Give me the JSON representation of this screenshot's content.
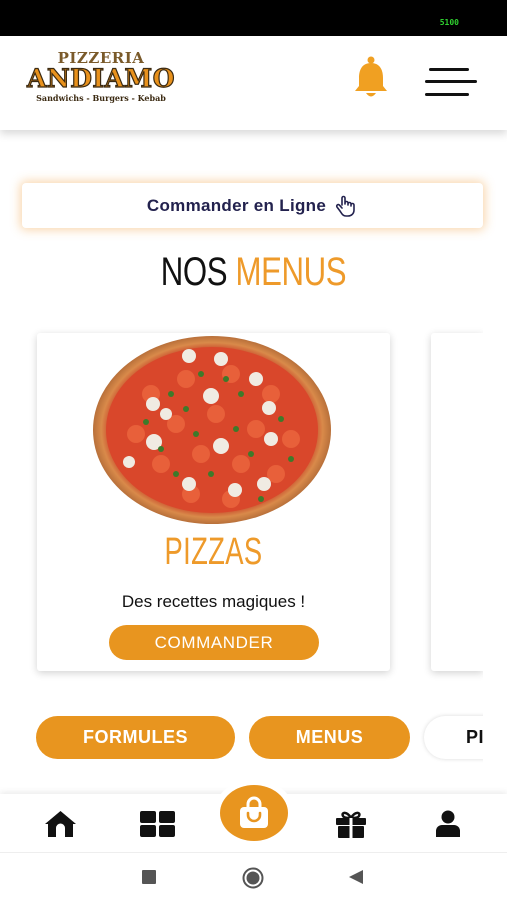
{
  "status": {
    "indicator": "5100"
  },
  "header": {
    "logo_line1": "PIZZERIA",
    "logo_line2": "ANDIAMO",
    "logo_line3": "Sandwichs - Burgers - Kebab",
    "bell_icon": "bell-icon",
    "menu_icon": "hamburger-icon"
  },
  "order_online": {
    "label": "Commander en Ligne",
    "icon": "hand-pointer-icon"
  },
  "section_title": {
    "part1": "NOS",
    "part2": "MENUS"
  },
  "card": {
    "title": "PIZZAS",
    "description": "Des recettes magiques !",
    "button": "COMMANDER"
  },
  "categories": [
    {
      "label": "FORMULES"
    },
    {
      "label": "MENUS"
    },
    {
      "label": "PI"
    }
  ],
  "bottom_nav": [
    "home-icon",
    "grid-icon",
    "shopping-bag-icon",
    "gift-icon",
    "user-icon"
  ],
  "colors": {
    "accent": "#e8951f",
    "navy": "#23224e"
  }
}
